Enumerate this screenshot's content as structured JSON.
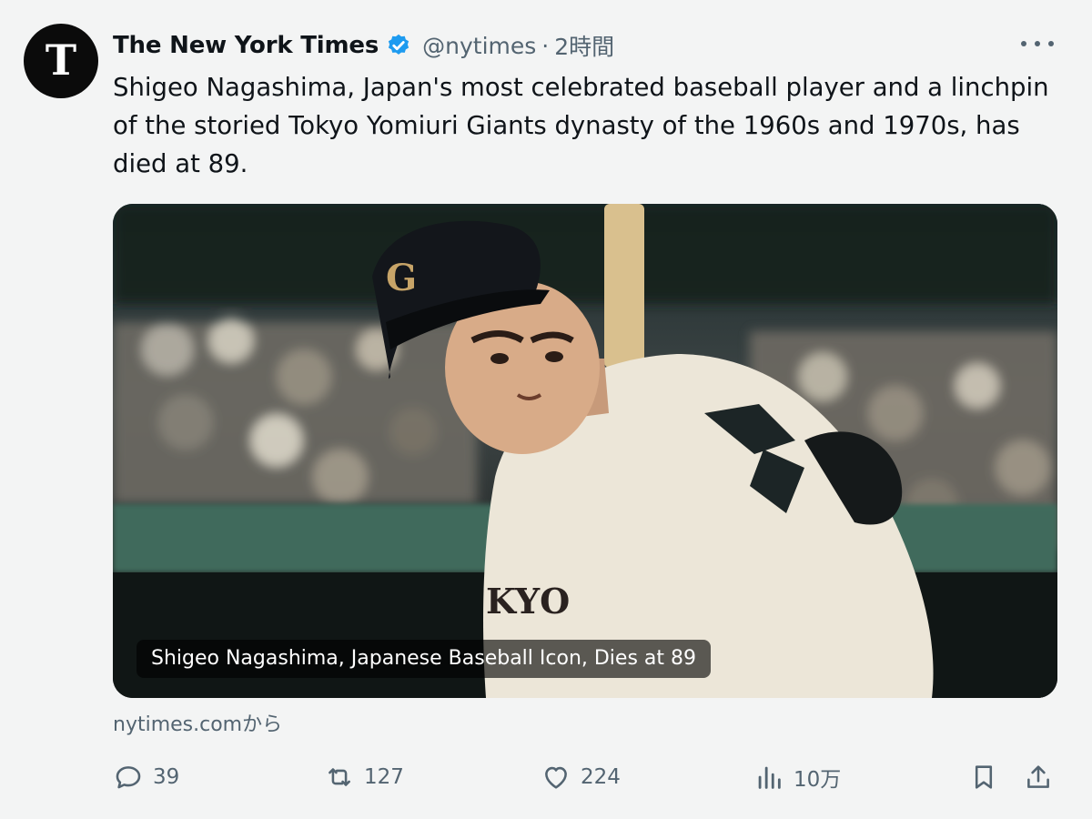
{
  "tweet": {
    "author": {
      "display_name": "The New York Times",
      "handle": "@nytimes",
      "avatar_glyph": "T",
      "verified": true,
      "verified_color": "#1d9bf0"
    },
    "separator": "·",
    "time": "2時間",
    "text": "Shigeo Nagashima, Japan's most celebrated baseball player and a linchpin of the storied Tokyo Yomiuri Giants dynasty of the 1960s and 1970s, has died at 89.",
    "card": {
      "title": "Shigeo Nagashima, Japanese Baseball Icon, Dies at 89",
      "source": "nytimes.comから"
    },
    "actions": {
      "reply_count": "39",
      "retweet_count": "127",
      "like_count": "224",
      "views_count": "10万"
    }
  },
  "icons": {
    "more": "more-icon",
    "reply": "reply-icon",
    "retweet": "retweet-icon",
    "like": "heart-icon",
    "views": "views-icon",
    "bookmark": "bookmark-icon",
    "share": "share-icon"
  }
}
